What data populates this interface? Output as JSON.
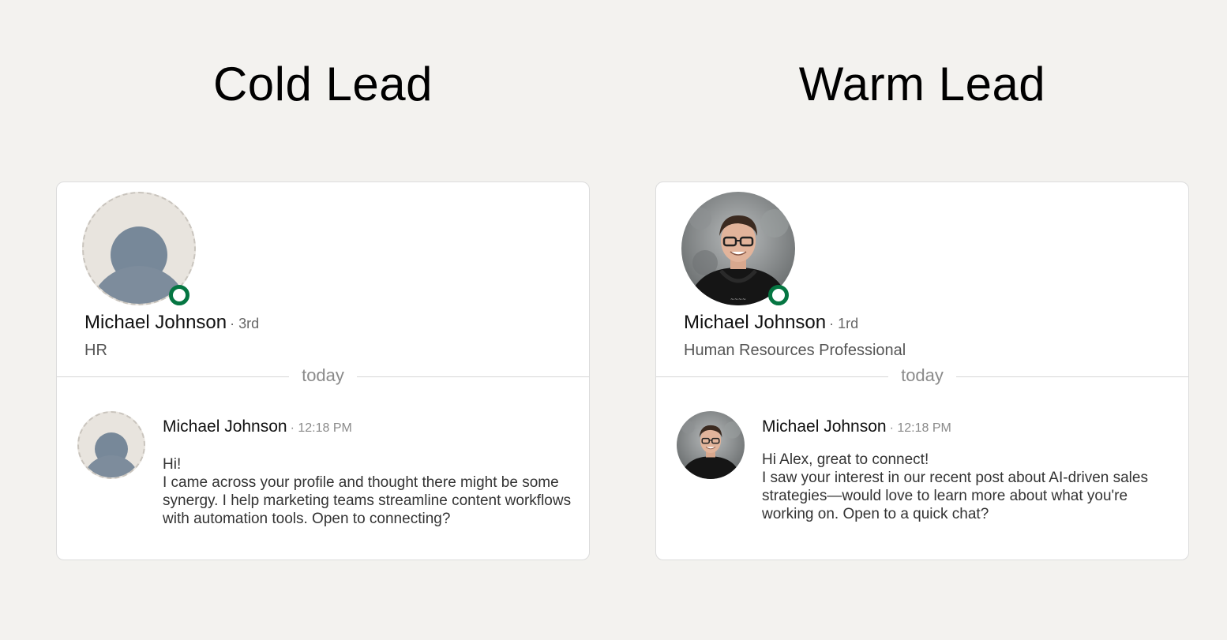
{
  "cold": {
    "title": "Cold Lead",
    "profile": {
      "name": "Michael Johnson",
      "degree": "· 3rd",
      "headline": "HR"
    },
    "divider": "today",
    "message": {
      "sender": "Michael Johnson",
      "time": "· 12:18 PM",
      "lines": [
        "Hi!",
        "I came across your profile and thought there might be some synergy. I help marketing teams streamline content workflows with automation tools. Open to connecting?"
      ]
    }
  },
  "warm": {
    "title": "Warm Lead",
    "profile": {
      "name": "Michael Johnson",
      "degree": "· 1rd",
      "headline": "Human Resources Professional"
    },
    "divider": "today",
    "message": {
      "sender": "Michael Johnson",
      "time": "· 12:18 PM",
      "lines": [
        "Hi Alex, great to connect!",
        "I saw your interest in our recent post about AI-driven sales strategies—would love to learn more about what you're working on. Open to a quick chat?"
      ]
    }
  },
  "colors": {
    "background": "#f3f2ef",
    "presence": "#057642",
    "placeholder": "#e8e4de",
    "silhouette": "#778899"
  }
}
